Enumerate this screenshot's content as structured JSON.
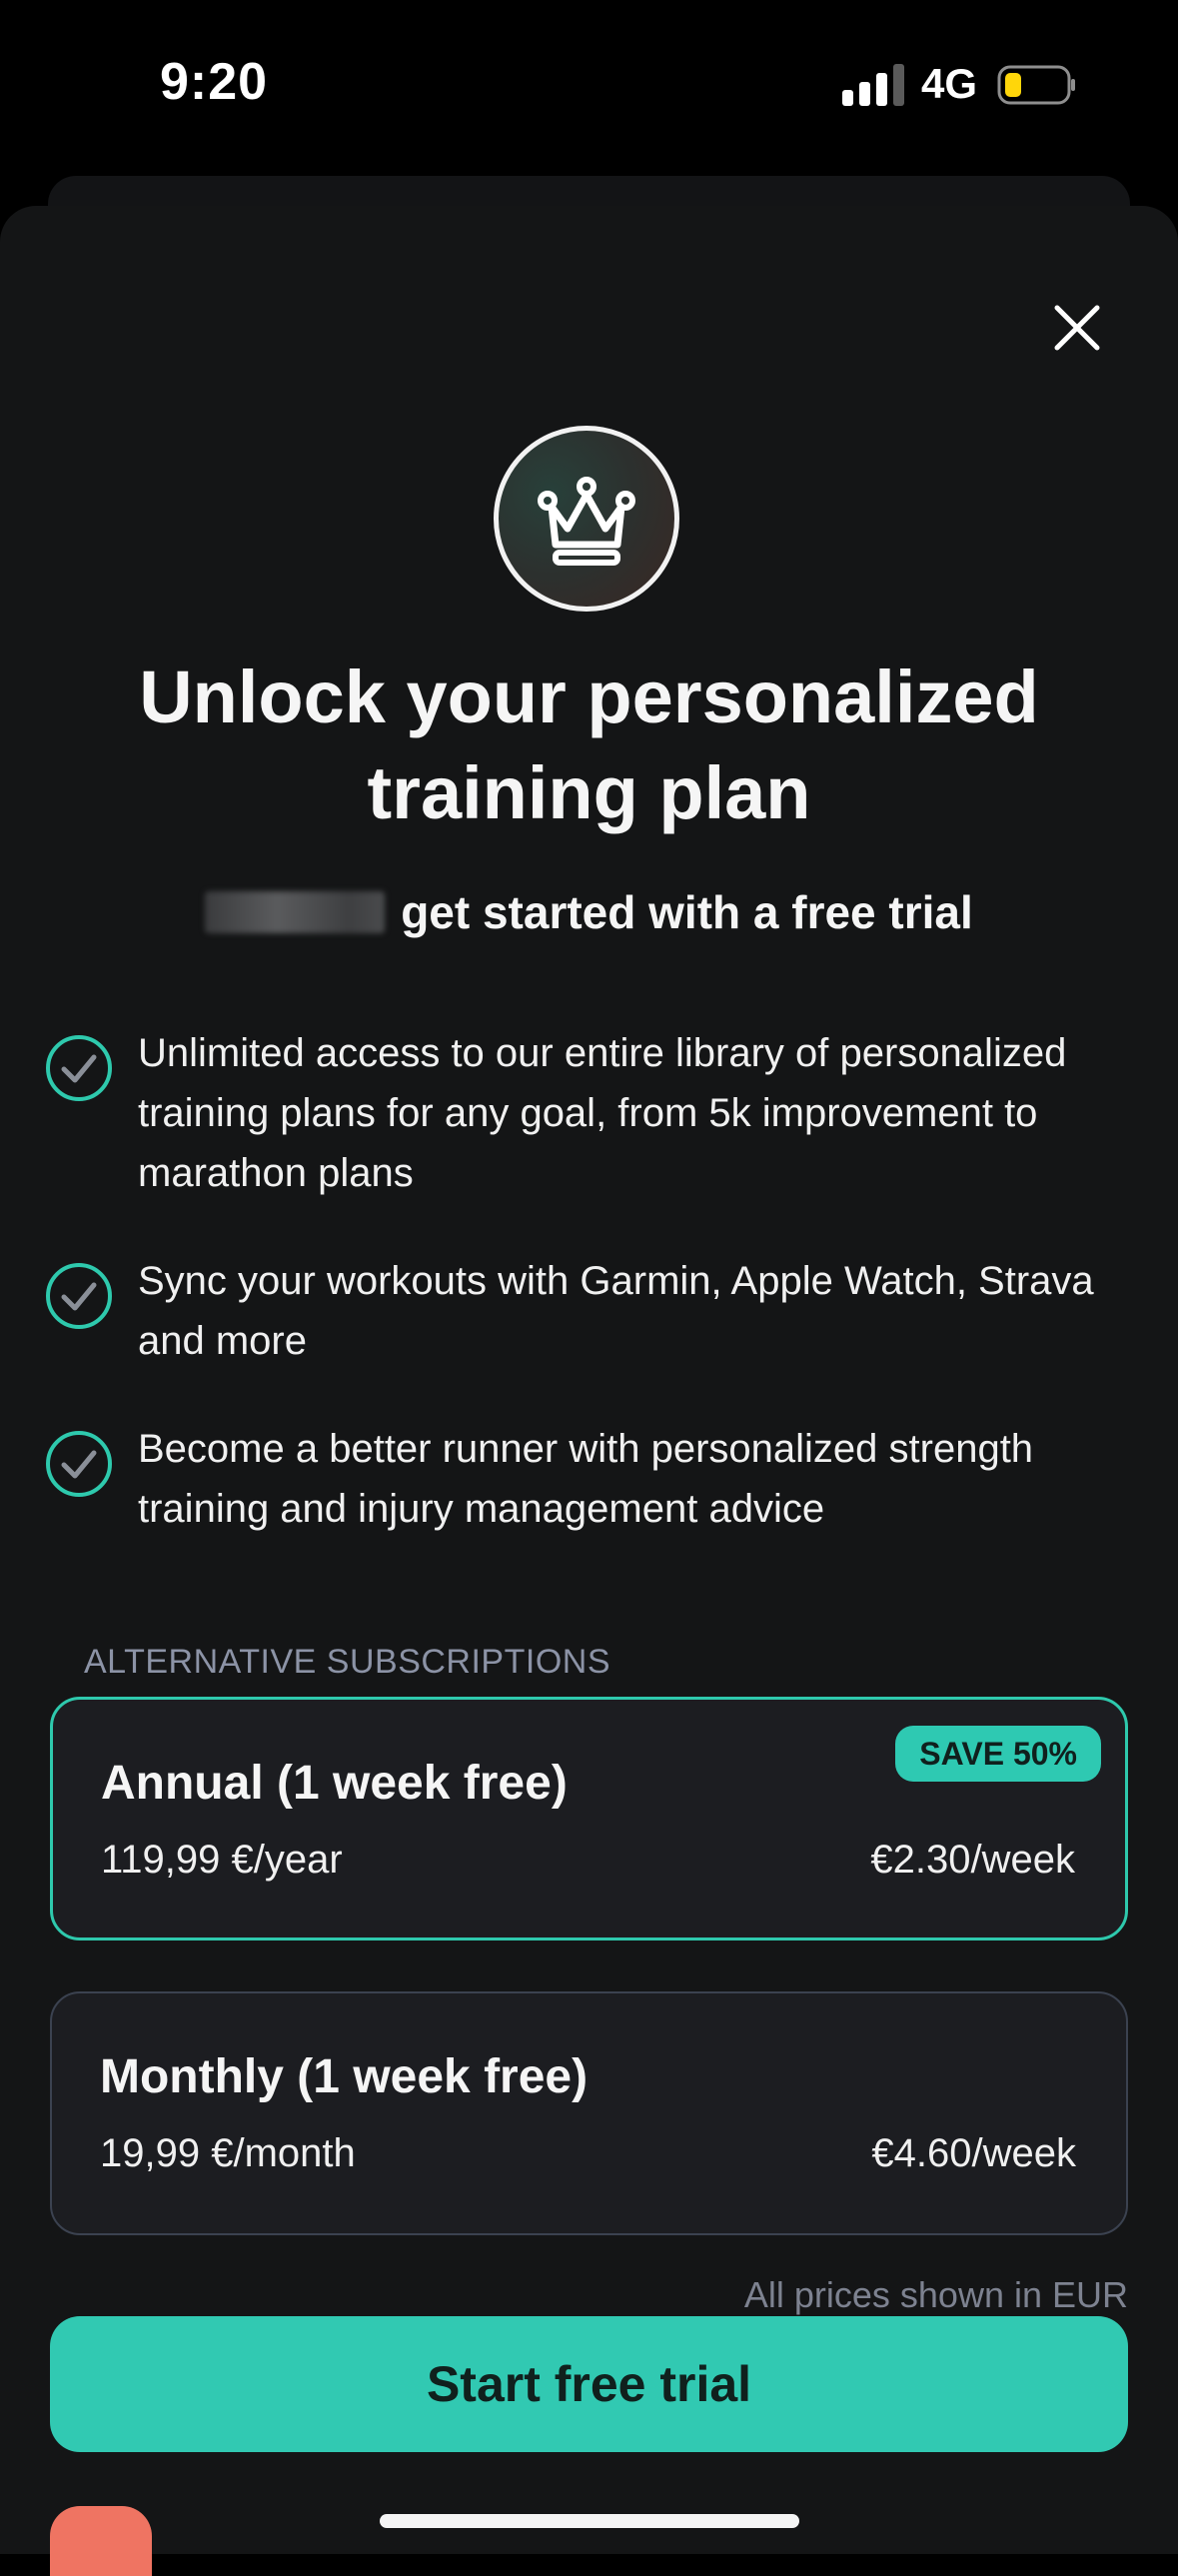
{
  "status_bar": {
    "time": "9:20",
    "network": "4G",
    "battery_icon": "battery-low-icon",
    "signal_icon": "cellular-signal-icon"
  },
  "header": {
    "close_icon": "close-icon",
    "badge_icon": "crown-icon",
    "title": "Unlock your personalized training plan",
    "subtitle": "get started with a free trial"
  },
  "features": [
    {
      "icon": "check-circle-icon",
      "text": "Unlimited access to our entire library of personalized training plans for any goal, from 5k improvement to marathon plans"
    },
    {
      "icon": "check-circle-icon",
      "text": "Sync your workouts with Garmin, Apple Watch, Strava and more"
    },
    {
      "icon": "check-circle-icon",
      "text": "Become a better runner with personalized strength training and injury management advice"
    }
  ],
  "subscriptions": {
    "section_label": "ALTERNATIVE SUBSCRIPTIONS",
    "plans": [
      {
        "name": "Annual (1 week free)",
        "price": "119,99 €/year",
        "weekly": "€2.30/week",
        "badge": "SAVE 50%",
        "selected": true
      },
      {
        "name": "Monthly (1 week free)",
        "price": "19,99 €/month",
        "weekly": "€4.60/week",
        "selected": false
      }
    ],
    "currency_note": "All prices shown in EUR"
  },
  "cta": {
    "label": "Start free trial"
  },
  "colors": {
    "accent": "#31c9b2",
    "background": "#141516",
    "card": "#1c1d21",
    "coral": "#ef7462"
  }
}
